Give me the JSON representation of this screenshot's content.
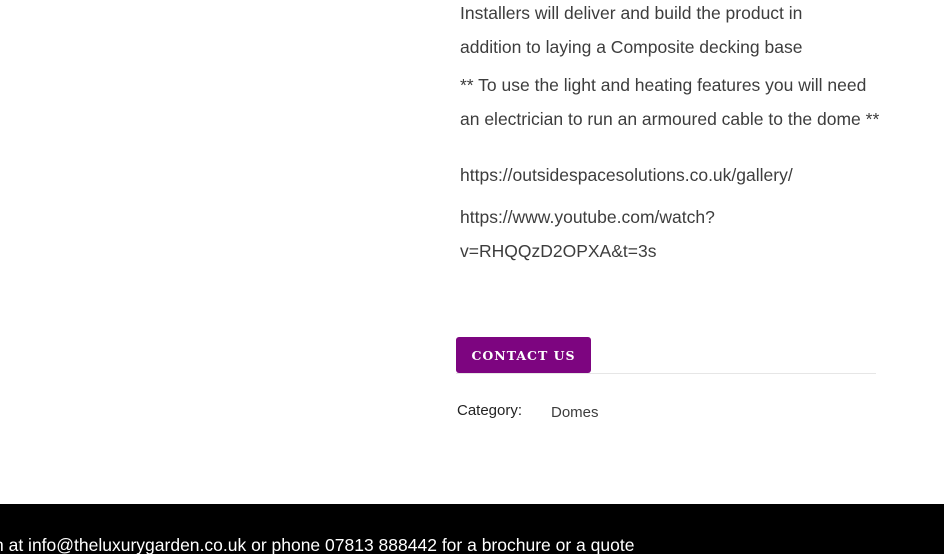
{
  "description": {
    "install_line1": "Installers will deliver and build the product in",
    "install_line2": "addition to laying a Composite decking base",
    "note": "** To use the light and heating features you will need an electrician to run an armoured cable to the dome **",
    "gallery_link": "https://outsidespacesolutions.co.uk/gallery/",
    "youtube_link_part1": "https://www.youtube.com/watch?",
    "youtube_link_part2": "v=RHQQzD2OPXA&t=3s"
  },
  "contact_button": {
    "label": "CONTACT US",
    "color": "#7d0580"
  },
  "meta": {
    "category_label": "Category:",
    "category_value": "Domes"
  },
  "footer": {
    "text": "n at info@theluxurygarden.co.uk or phone 07813 888442 for a brochure or a quote"
  }
}
